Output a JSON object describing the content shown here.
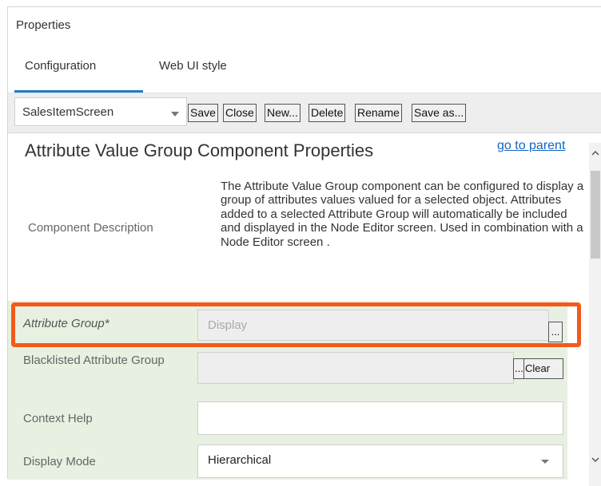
{
  "panel": {
    "title": "Properties"
  },
  "tabs": [
    {
      "label": "Configuration",
      "active": true
    },
    {
      "label": "Web UI style",
      "active": false
    }
  ],
  "toolbar": {
    "screen_select": "SalesItemScreen",
    "buttons": [
      "Save",
      "Close",
      "New...",
      "Delete",
      "Rename",
      "Save as..."
    ]
  },
  "content": {
    "heading": "Attribute Value Group Component Properties",
    "parent_link": "go to parent",
    "description": {
      "label": "Component Description",
      "text": "The Attribute Value Group component can be configured to display a group of attributes values valued for a selected object. Attributes added to a selected Attribute Group will automatically be included and displayed in the Node Editor screen. Used in combination with a Node Editor screen ."
    }
  },
  "fields": {
    "attribute_group": {
      "label": "Attribute Group*",
      "value": "Display",
      "button": "..."
    },
    "blacklisted_group": {
      "label": "Blacklisted Attribute Group",
      "value": "",
      "browse_button": "...",
      "clear_button": "Clear"
    },
    "context_help": {
      "label": "Context Help",
      "value": ""
    },
    "display_mode": {
      "label": "Display Mode",
      "value": "Hierarchical"
    }
  },
  "colors": {
    "accent": "#1e7ac9",
    "highlight": "#f25a1b",
    "form_background": "#e8f0e1",
    "link": "#1565c0"
  }
}
